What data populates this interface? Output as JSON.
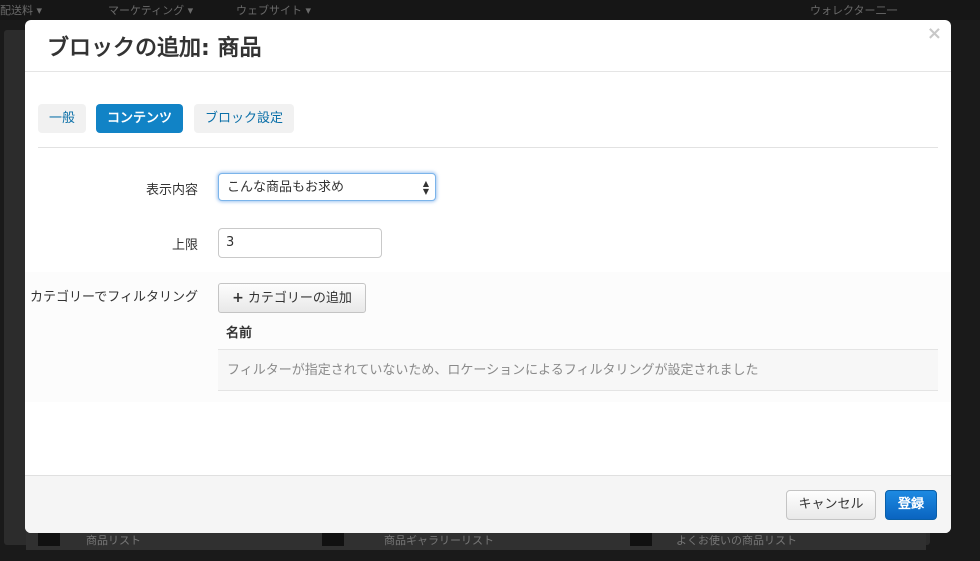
{
  "background": {
    "menu_items": [
      "配送料 ▾",
      "マーケティング ▾",
      "ウェブサイト ▾"
    ],
    "user_menu": "ウォレクター二一",
    "bottom_items": [
      "商品リスト",
      "商品ギャラリーリスト",
      "よくお使いの商品リスト"
    ]
  },
  "modal": {
    "title": "ブロックの追加: 商品",
    "close_label": "×",
    "tabs": [
      {
        "label": "一般",
        "active": false
      },
      {
        "label": "コンテンツ",
        "active": true
      },
      {
        "label": "ブロック設定",
        "active": false
      }
    ],
    "fields": {
      "content_label": "表示内容",
      "content_value": "こんな商品もお求め",
      "limit_label": "上限",
      "limit_value": "3",
      "category_filter_label": "カテゴリーでフィルタリング"
    },
    "filter": {
      "add_button_label": "カテゴリーの追加",
      "column_name": "名前",
      "empty_message": "フィルターが指定されていないため、ロケーションによるフィルタリングが設定されました"
    },
    "footer": {
      "cancel_label": "キャンセル",
      "submit_label": "登録"
    }
  },
  "colors": {
    "accent": "#1183c6",
    "primary_button": "#0a64c0",
    "overlay": "#1a1a1a"
  }
}
